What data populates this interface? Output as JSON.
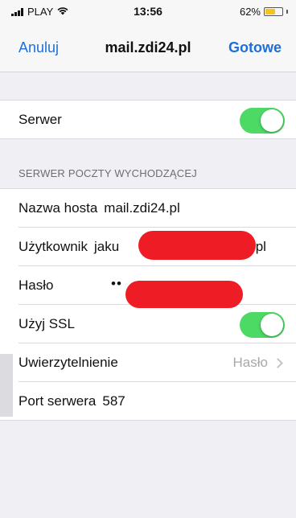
{
  "status_bar": {
    "carrier": "PLAY",
    "time": "13:56",
    "battery_percent": "62%",
    "battery_level": 0.62,
    "battery_color": "#f5c518"
  },
  "nav": {
    "cancel_label": "Anuluj",
    "title": "mail.zdi24.pl",
    "done_label": "Gotowe"
  },
  "server_row": {
    "label": "Serwer",
    "enabled": true
  },
  "section_header": "SERWER POCZTY WYCHODZĄCEJ",
  "fields": {
    "host": {
      "label": "Nazwa hosta",
      "value": "mail.zdi24.pl"
    },
    "user": {
      "label": "Użytkownik",
      "value_start": "jaku",
      "value_end": ".pl"
    },
    "password": {
      "label": "Hasło",
      "masked": "••"
    },
    "ssl": {
      "label": "Użyj SSL",
      "enabled": true
    },
    "auth": {
      "label": "Uwierzytelnienie",
      "value": "Hasło"
    },
    "port": {
      "label": "Port serwera",
      "value": "587"
    }
  },
  "colors": {
    "accent": "#1f6fd8",
    "toggle_on": "#4cd964",
    "redaction": "#ee1c25",
    "background": "#efeff4"
  }
}
